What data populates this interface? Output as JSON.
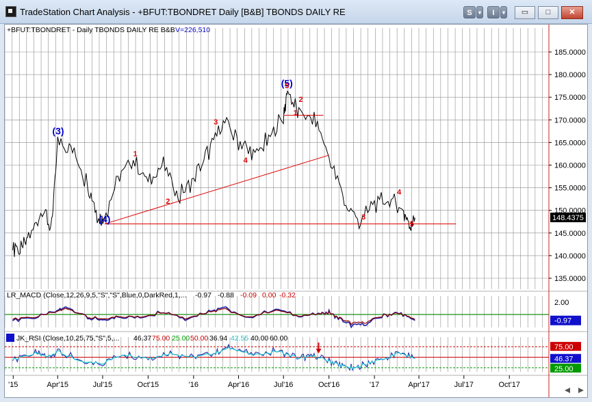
{
  "window": {
    "title": "TradeStation Chart Analysis - +BFUT:TBONDRET Daily [B&B] TBONDS DAILY RE",
    "btn_s": "S",
    "btn_i": "I",
    "btn_min": "▭",
    "btn_max": "□",
    "btn_close": "✕"
  },
  "colors": {
    "price": "#000000",
    "wave_label_major": "#0000cc",
    "wave_label_minor": "#dd0000",
    "trendline": "#dd0000",
    "macd_blue": "#1f1fa0",
    "macd_red": "#8b0000",
    "macd_green": "#1a8f1a",
    "rsi_blue": "#1f1fa0",
    "rsi_cyan": "#20c0d0",
    "rsi_red_line": "#cc0000",
    "rsi_green_line": "#009900"
  },
  "chart_data": [
    {
      "type": "line",
      "pane": "price",
      "legend": "+BFUT:TBONDRET - Daily  TBONDS DAILY RE  B&B  V=226,510",
      "legend_parts": {
        "symbol": "+BFUT:TBONDRET - Daily  TBONDS DAILY RE  B&B",
        "volume": "V=226,510"
      },
      "yticks": [
        "185.0000",
        "180.0000",
        "175.0000",
        "170.0000",
        "165.0000",
        "160.0000",
        "155.0000",
        "150.0000",
        "145.0000",
        "140.0000",
        "135.0000"
      ],
      "ylim": [
        131,
        188
      ],
      "last_price_label": "148.4375",
      "last_price": 148.44,
      "x_dates": [
        "2014-12-31",
        "2015-01-15",
        "2015-02-01",
        "2015-03-01",
        "2015-03-20",
        "2015-04-01",
        "2015-05-01",
        "2015-06-01",
        "2015-06-20",
        "2015-07-01",
        "2015-08-01",
        "2015-09-01",
        "2015-10-01",
        "2015-11-01",
        "2015-12-01",
        "2016-01-01",
        "2016-02-01",
        "2016-03-01",
        "2016-04-01",
        "2016-05-01",
        "2016-06-01",
        "2016-07-01",
        "2016-07-10",
        "2016-08-01",
        "2016-09-01",
        "2016-10-01",
        "2016-11-01",
        "2016-12-01",
        "2017-01-01",
        "2017-02-01",
        "2017-03-01",
        "2017-03-14",
        "2017-03-24"
      ],
      "y_close": [
        142.0,
        141.0,
        144.0,
        151.0,
        146.0,
        166.0,
        163.0,
        156.0,
        149.0,
        147.5,
        157.0,
        161.5,
        156.0,
        160.0,
        153.0,
        157.0,
        163.0,
        169.5,
        165.0,
        162.0,
        165.5,
        171.0,
        176.5,
        171.5,
        170.0,
        162.0,
        152.0,
        147.5,
        151.5,
        152.5,
        149.5,
        146.5,
        148.4
      ],
      "wave_labels": [
        {
          "text": "(3)",
          "x": "2015-04-02",
          "y": 166.8,
          "major": true
        },
        {
          "text": "(4)",
          "x": "2015-07-05",
          "y": 147.3,
          "major": true
        },
        {
          "text": "(5)",
          "x": "2016-07-08",
          "y": 177.4,
          "major": true
        },
        {
          "text": "1",
          "x": "2015-09-05",
          "y": 162.0,
          "major": false
        },
        {
          "text": "2",
          "x": "2015-11-10",
          "y": 151.5,
          "major": false
        },
        {
          "text": "3",
          "x": "2016-02-15",
          "y": 169.0,
          "major": false
        },
        {
          "text": "4",
          "x": "2016-04-15",
          "y": 160.5,
          "major": false
        },
        {
          "text": "5",
          "x": "2016-07-08",
          "y": 177.0,
          "major": false
        },
        {
          "text": "1",
          "x": "2016-07-25",
          "y": 171.0,
          "major": false
        },
        {
          "text": "2",
          "x": "2016-08-05",
          "y": 174.0,
          "major": false
        },
        {
          "text": "3",
          "x": "2016-12-10",
          "y": 148.0,
          "major": false
        },
        {
          "text": "4",
          "x": "2017-02-20",
          "y": 153.5,
          "major": false
        },
        {
          "text": "5",
          "x": "2017-03-18",
          "y": 146.5,
          "major": false
        }
      ],
      "trendlines": [
        {
          "x": [
            "2015-07-05",
            "2016-10-01"
          ],
          "y": [
            147.0,
            162.2
          ]
        },
        {
          "x": [
            "2015-07-05",
            "2017-06-15"
          ],
          "y": [
            147.0,
            147.0
          ]
        },
        {
          "x": [
            "2016-07-01",
            "2016-09-20"
          ],
          "y": [
            171.0,
            171.0
          ]
        }
      ]
    },
    {
      "type": "line",
      "pane": "macd",
      "legend_name": "LR_MACD (Close,12,26,9,5,\"S\",\"S\",Blue,0,DarkRed,1,...",
      "legend_values": [
        "-0.97",
        "-0.88",
        "-0.09",
        "0.00",
        "-0.32"
      ],
      "yticks": [
        "2.00",
        "-0.97"
      ],
      "last_value_label": "-0.97",
      "series": [
        {
          "name": "MACD",
          "values": [
            -0.9,
            -0.5,
            0.6,
            1.4,
            -0.5,
            -1.0,
            -0.3,
            -0.6,
            0.6,
            -0.7,
            0.5,
            1.2,
            -0.6,
            0.9,
            -0.3,
            0.1,
            0.4,
            -0.6,
            -1.8,
            -1.6,
            -0.2,
            0.2,
            -0.97
          ]
        }
      ],
      "x_dates": [
        "2014-12-31",
        "2015-02-15",
        "2015-04-01",
        "2015-04-20",
        "2015-06-01",
        "2015-07-01",
        "2015-08-01",
        "2015-09-15",
        "2015-11-01",
        "2015-12-15",
        "2016-02-01",
        "2016-03-01",
        "2016-04-15",
        "2016-06-15",
        "2016-08-01",
        "2016-09-15",
        "2016-10-01",
        "2016-10-20",
        "2016-11-15",
        "2016-12-15",
        "2017-01-20",
        "2017-02-20",
        "2017-03-24"
      ]
    },
    {
      "type": "line",
      "pane": "rsi",
      "legend_name": "JK_RSI (Close,10,25,75,\"S\",5,...",
      "legend_values": [
        "46.37",
        "75.00",
        "25.00",
        "50.00",
        "36.94",
        "42.55",
        "40.00",
        "60.00"
      ],
      "yticks": [
        "75.00",
        "46.37",
        "25.00"
      ],
      "levels": {
        "upper": 75,
        "lower": 25
      },
      "series": [
        {
          "name": "RSI",
          "values": [
            45,
            60,
            52,
            66,
            40,
            36,
            58,
            48,
            60,
            50,
            62,
            74,
            55,
            66,
            48,
            53,
            40,
            30,
            22,
            36,
            48,
            62,
            46.37
          ]
        }
      ],
      "x_dates": [
        "2014-12-31",
        "2015-02-15",
        "2015-03-10",
        "2015-04-01",
        "2015-05-15",
        "2015-07-01",
        "2015-08-15",
        "2015-10-01",
        "2015-11-15",
        "2016-01-01",
        "2016-02-15",
        "2016-03-15",
        "2016-05-01",
        "2016-06-20",
        "2016-08-01",
        "2016-09-01",
        "2016-10-01",
        "2016-10-25",
        "2016-11-20",
        "2016-12-20",
        "2017-01-25",
        "2017-02-20",
        "2017-03-24"
      ]
    }
  ],
  "time_axis": {
    "labels": [
      "'15",
      "Apr'15",
      "Jul'15",
      "Oct'15",
      "'16",
      "Apr'16",
      "Jul'16",
      "Oct'16",
      "'17",
      "Apr'17",
      "Jul'17",
      "Oct'17"
    ],
    "dates": [
      "2015-01-01",
      "2015-04-01",
      "2015-07-01",
      "2015-10-01",
      "2016-01-01",
      "2016-04-01",
      "2016-07-01",
      "2016-10-01",
      "2017-01-01",
      "2017-04-01",
      "2017-07-01",
      "2017-10-01"
    ]
  },
  "rsi_marker": {
    "x": "2016-09-10"
  }
}
